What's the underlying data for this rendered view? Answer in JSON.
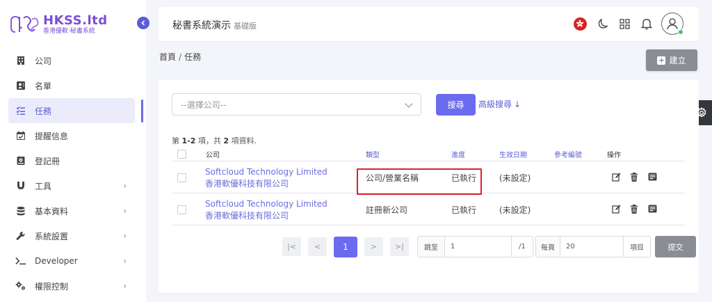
{
  "brand": {
    "title": "HKSS.ltd",
    "subtitle": "香港優軟·秘書系統",
    "color": "#7a4fd6"
  },
  "sidebar": {
    "items": [
      {
        "label": "公司",
        "icon": "building-icon",
        "expandable": false,
        "active": false
      },
      {
        "label": "名單",
        "icon": "contact-card-icon",
        "expandable": false,
        "active": false
      },
      {
        "label": "任務",
        "icon": "task-list-icon",
        "expandable": false,
        "active": true
      },
      {
        "label": "提醒信息",
        "icon": "calendar-check-icon",
        "expandable": false,
        "active": false
      },
      {
        "label": "登記冊",
        "icon": "register-book-icon",
        "expandable": false,
        "active": false
      },
      {
        "label": "工具",
        "icon": "magnet-icon",
        "expandable": true,
        "active": false
      },
      {
        "label": "基本資料",
        "icon": "database-icon",
        "expandable": true,
        "active": false
      },
      {
        "label": "系統設置",
        "icon": "wrench-icon",
        "expandable": true,
        "active": false
      },
      {
        "label": "Developer",
        "icon": "terminal-icon",
        "expandable": true,
        "active": false
      },
      {
        "label": "權限控制",
        "icon": "cogs-icon",
        "expandable": true,
        "active": false
      }
    ],
    "chevron": "›"
  },
  "header": {
    "title": "秘書系統演示",
    "edition": "基礎版"
  },
  "breadcrumb": {
    "home": "首頁",
    "separator": "/",
    "current": "任務"
  },
  "toolbar": {
    "create_label": "建立"
  },
  "filters": {
    "company_placeholder": "--選擇公司--",
    "search_label": "搜尋",
    "advanced_search_label": "高級搜尋"
  },
  "records": {
    "prefix": "第",
    "range": "1-2",
    "middle": "項，共",
    "total": "2",
    "suffix": "項資料."
  },
  "table": {
    "columns": {
      "company": "公司",
      "type": "類型",
      "progress": "進度",
      "effective_date": "生效日期",
      "reference": "參考編號",
      "operations": "操作"
    },
    "rows": [
      {
        "company_en": "Softcloud Technology Limited",
        "company_zh": "香港軟優科技有限公司",
        "type": "公司/營業名稱",
        "progress": "已執行",
        "effective_date": "(未設定)",
        "reference": ""
      },
      {
        "company_en": "Softcloud Technology Limited",
        "company_zh": "香港軟優科技有限公司",
        "type": "註冊新公司",
        "progress": "已執行",
        "effective_date": "(未設定)",
        "reference": ""
      }
    ]
  },
  "pagination": {
    "first": "|<",
    "prev": "<",
    "current": "1",
    "next": ">",
    "last": ">|",
    "jump_label": "跳至",
    "jump_value": "1",
    "total_pages": "/1",
    "per_page_label": "每頁",
    "per_page_value": "20",
    "per_page_suffix": "項目",
    "submit_label": "提交"
  },
  "colors": {
    "accent": "#6b6bef",
    "link": "#6b6be0",
    "highlight": "#d8232a",
    "neutral_button": "#8a8d93"
  }
}
